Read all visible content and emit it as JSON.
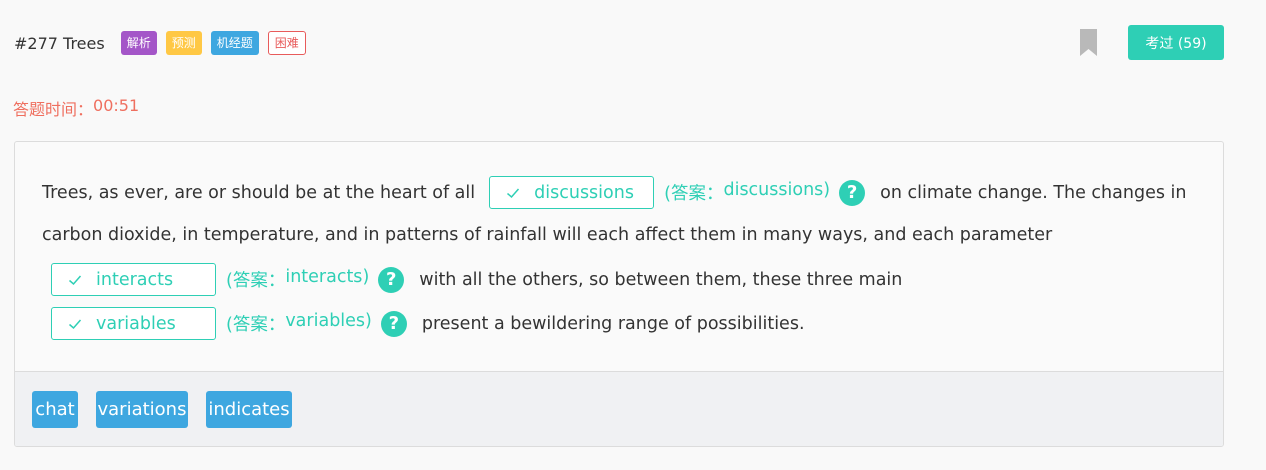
{
  "header": {
    "question_id": "#277 Trees",
    "tags": [
      {
        "label": "解析",
        "color": "#a456c8"
      },
      {
        "label": "预测",
        "color": "#ffc845"
      },
      {
        "label": "机经题",
        "color": "#3ea7e0"
      },
      {
        "label": "困难",
        "color": "#e85b5b"
      }
    ],
    "bookmark_icon": "bookmark-icon",
    "pass_button": "考过 (59)"
  },
  "timer": {
    "label": "答题时间：",
    "value": "00:51"
  },
  "passage": {
    "line1_before": "Trees, as ever, are or should be at the heart of all",
    "line1_after": "on climate change. The changes in",
    "line2": "carbon dioxide, in temperature, and in patterns of rainfall will each affect them in many ways, and each parameter",
    "line3_after": "with all the others, so between them, these three main",
    "line4_after": "present a bewildering range of possibilities.",
    "blanks": [
      {
        "filled": "discussions",
        "answer_prefix": "(答案：",
        "answer": "discussions",
        "answer_suffix": ")"
      },
      {
        "filled": "interacts",
        "answer_prefix": "(答案：",
        "answer": "interacts",
        "answer_suffix": ")"
      },
      {
        "filled": "variables",
        "answer_prefix": "(答案：",
        "answer": "variables",
        "answer_suffix": ")"
      }
    ],
    "help_icon_symbol": "?"
  },
  "word_bank": [
    "chat",
    "variations",
    "indicates"
  ],
  "colors": {
    "accent": "#2ecfb5",
    "timer": "#ef6f5f",
    "chip": "#3ea7e0"
  }
}
